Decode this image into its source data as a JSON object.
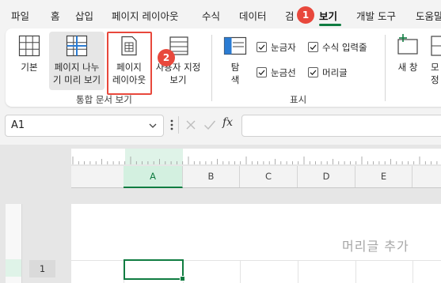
{
  "menu": {
    "items": [
      "파일",
      "홈",
      "삽입",
      "페이지 레이아웃",
      "수식",
      "데이터",
      "검",
      "보기",
      "개발 도구",
      "도움말"
    ],
    "active_index": 7
  },
  "callouts": {
    "first": "1",
    "second": "2"
  },
  "ribbon": {
    "workbook_views": {
      "normal": "기본",
      "page_break_preview": [
        "페이지 나누",
        "기 미리 보기"
      ],
      "page_layout": [
        "페이지",
        "레이아웃"
      ],
      "custom_views": [
        "사용자 지정",
        "보기"
      ],
      "group_label": "통합 문서 보기"
    },
    "show": {
      "navigation": [
        "탐",
        "색"
      ],
      "ruler": "눈금자",
      "gridlines": "눈금선",
      "formula_bar": "수식 입력줄",
      "headings": "머리글",
      "ruler_checked": true,
      "gridlines_checked": true,
      "formula_bar_checked": true,
      "headings_checked": true,
      "group_label": "표시"
    },
    "window": {
      "new_window": "새 창",
      "arrange": [
        "모",
        "정"
      ]
    }
  },
  "formula_bar": {
    "name_box": "A1",
    "fx": "fx",
    "value": ""
  },
  "sheet": {
    "columns": [
      "A",
      "B",
      "C",
      "D",
      "E"
    ],
    "selected_column": "A",
    "row_number": "1",
    "header_placeholder": "머리글 추가"
  },
  "colors": {
    "accent": "#107c41",
    "callout": "#e8483c"
  }
}
